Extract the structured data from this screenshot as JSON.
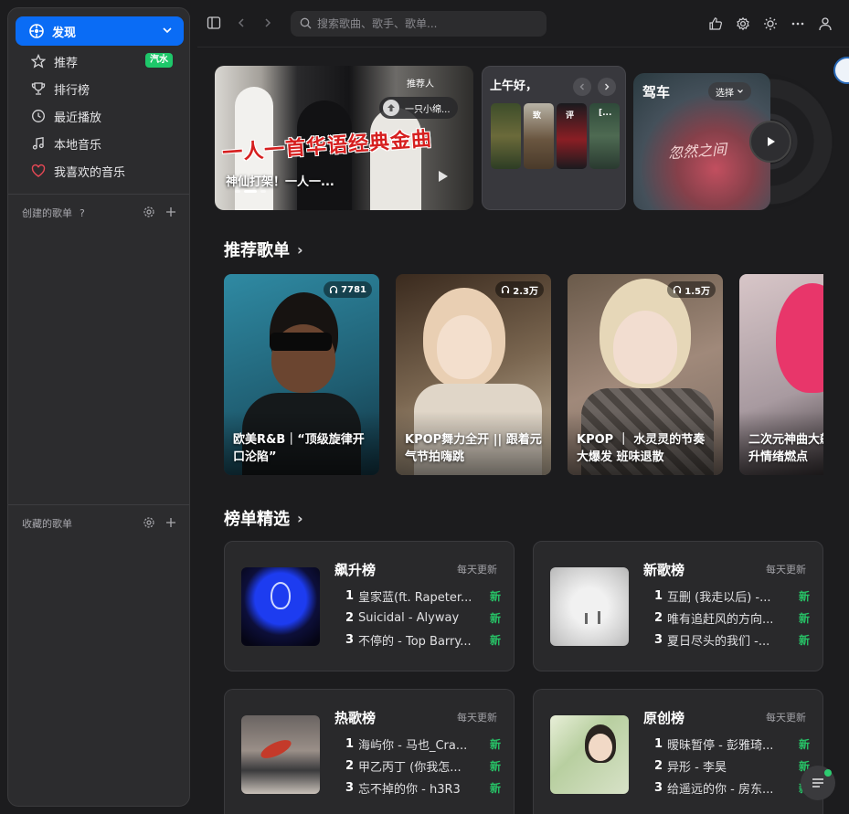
{
  "sidebar": {
    "active": {
      "label": "发现",
      "icon": "discover-icon"
    },
    "items": [
      {
        "label": "推荐",
        "icon": "star-icon",
        "badge": "汽水"
      },
      {
        "label": "排行榜",
        "icon": "trophy-icon"
      },
      {
        "label": "最近播放",
        "icon": "clock-icon"
      },
      {
        "label": "本地音乐",
        "icon": "music-note-icon"
      },
      {
        "label": "我喜欢的音乐",
        "icon": "heart-icon"
      }
    ],
    "created_section": {
      "label": "创建的歌单",
      "help": "?"
    },
    "collected_section": {
      "label": "收藏的歌单"
    }
  },
  "topbar": {
    "search_placeholder": "搜索歌曲、歌手、歌单..."
  },
  "banners": {
    "main": {
      "title_art": "一人一首华语经典金曲",
      "caption": "神仙打架！一人一...",
      "rec_label": "推荐人",
      "rec_user": "一只小绵..."
    },
    "greeting": {
      "label": "上午好，",
      "thumbs": [
        "致",
        "评",
        "[..."
      ]
    },
    "drive": {
      "label": "驾车",
      "select": "选择",
      "art": "忽然之间"
    }
  },
  "recommended": {
    "title": "推荐歌单",
    "playlists": [
      {
        "name": "欧美R&B｜“顶级旋律开口沦陷”",
        "count": "7781"
      },
      {
        "name": "KPOP舞力全开 || 跟着元气节拍嗨跳",
        "count": "2.3万"
      },
      {
        "name": "KPOP ｜ 水灵灵的节奏大爆发 班味退散",
        "count": "1.5万"
      },
      {
        "name": "二次元神曲大飙升情绪燃点",
        "count": ""
      }
    ]
  },
  "charts": {
    "title": "榜单精选",
    "cards": [
      {
        "title": "飙升榜",
        "update": "每天更新",
        "songs": [
          "皇家蓝(ft. Rapeter...",
          "Suicidal - Alyway",
          "不停的 - Top Barry..."
        ],
        "badges": [
          "新",
          "新",
          "新"
        ]
      },
      {
        "title": "新歌榜",
        "update": "每天更新",
        "songs": [
          "互删 (我走以后) -...",
          "唯有追赶风的方向...",
          "夏日尽头的我们 -..."
        ],
        "badges": [
          "新",
          "新",
          "新"
        ]
      },
      {
        "title": "热歌榜",
        "update": "每天更新",
        "songs": [
          "海屿你 - 马也_Cra...",
          "甲乙丙丁 (你我怎...",
          "忘不掉的你 - h3R3"
        ],
        "badges": [
          "新",
          "新",
          "新"
        ]
      },
      {
        "title": "原创榜",
        "update": "每天更新",
        "songs": [
          "暧昧暂停 - 彭雅琦...",
          "异形 - 李昊",
          "给遥远的你 - 房东..."
        ],
        "badges": [
          "新",
          "新",
          "新"
        ]
      }
    ]
  },
  "colors": {
    "accent": "#0a6cf5",
    "new_badge": "#27c166",
    "badge_green": "#1ec76a"
  }
}
